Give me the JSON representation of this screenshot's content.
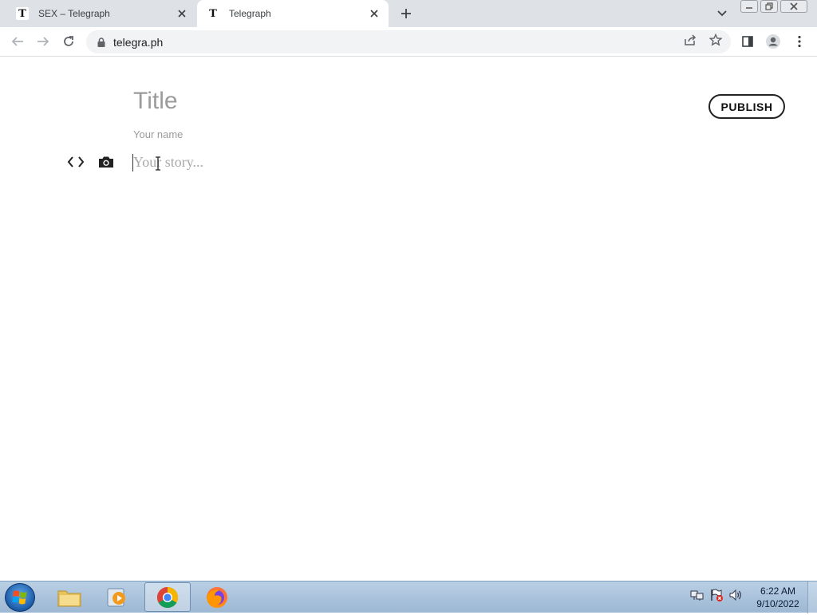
{
  "browser": {
    "tabs": [
      {
        "title": "SEX – Telegraph",
        "favicon": "T",
        "active": false
      },
      {
        "title": "Telegraph",
        "favicon": "T",
        "active": true
      }
    ],
    "url": "telegra.ph"
  },
  "editor": {
    "title_placeholder": "Title",
    "name_placeholder": "Your name",
    "story_placeholder": "Your story...",
    "publish_label": "PUBLISH"
  },
  "taskbar": {
    "time": "6:22 AM",
    "date": "9/10/2022"
  },
  "icons": {
    "tab_close": "close-icon",
    "new_tab": "plus-icon",
    "back": "arrow-left-icon",
    "forward": "arrow-right-icon",
    "reload": "reload-icon",
    "lock": "lock-icon",
    "share": "share-icon",
    "bookmark": "star-icon",
    "side_panel": "side-panel-icon",
    "profile": "profile-icon",
    "menu": "kebab-menu-icon",
    "embed": "code-brackets-icon",
    "image": "camera-icon"
  }
}
